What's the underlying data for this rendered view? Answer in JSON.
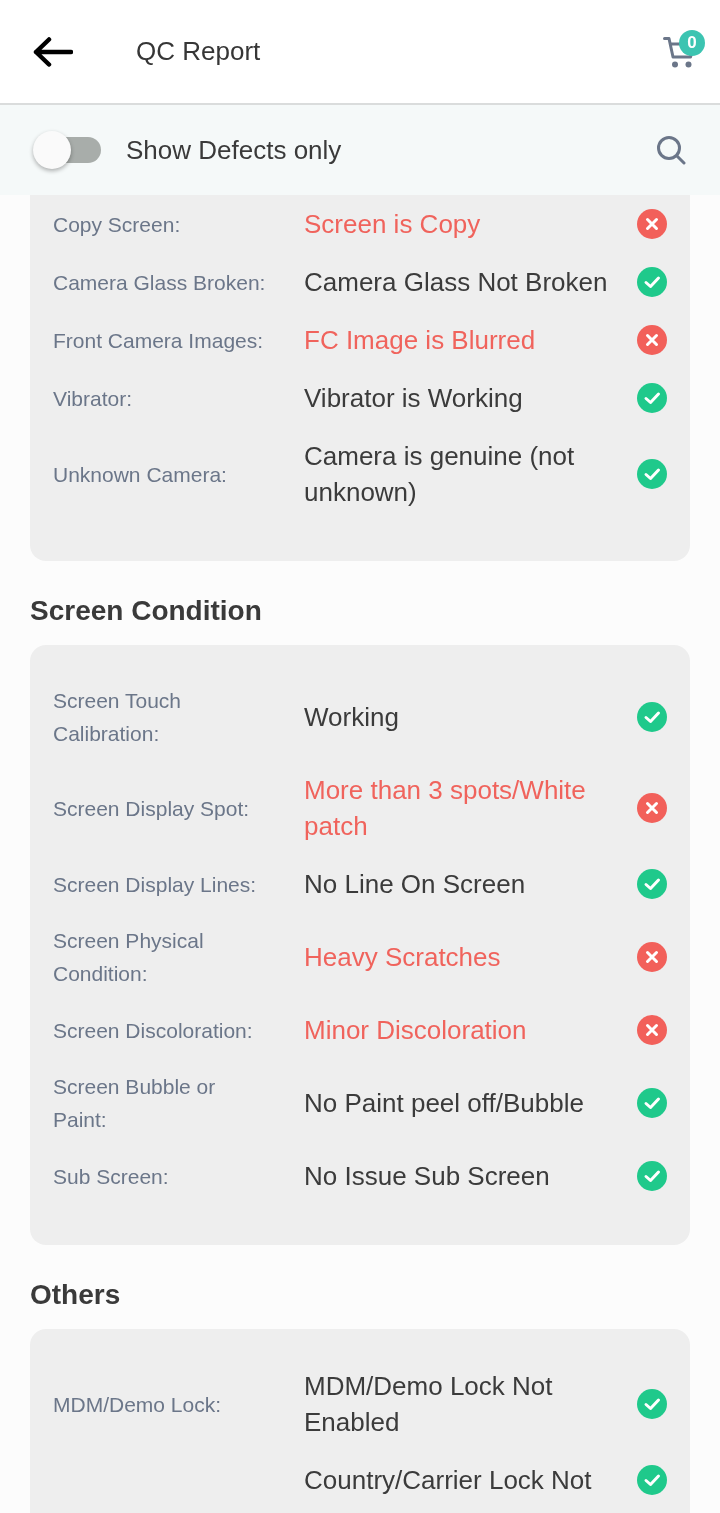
{
  "header": {
    "title": "QC Report",
    "cart_count": "0"
  },
  "filter": {
    "label": "Show Defects only",
    "on": false
  },
  "sections": [
    {
      "rows": [
        {
          "label": "Copy Screen:",
          "value": "Screen is Copy",
          "defect": true
        },
        {
          "label": "Camera Glass Broken:",
          "value": "Camera Glass Not Broken",
          "defect": false
        },
        {
          "label": "Front Camera Images:",
          "value": "FC Image is Blurred",
          "defect": true
        },
        {
          "label": "Vibrator:",
          "value": "Vibrator is Working",
          "defect": false
        },
        {
          "label": "Unknown Camera:",
          "value": "Camera is genuine (not unknown)",
          "defect": false
        }
      ]
    },
    {
      "title": "Screen Condition",
      "rows": [
        {
          "label": "Screen Touch Calibration:",
          "value": "Working",
          "defect": false
        },
        {
          "label": "Screen Display Spot:",
          "value": "More than 3 spots/White patch",
          "defect": true
        },
        {
          "label": "Screen Display Lines:",
          "value": "No Line On Screen",
          "defect": false
        },
        {
          "label": "Screen Physical Condition:",
          "value": "Heavy Scratches",
          "defect": true
        },
        {
          "label": "Screen Discoloration:",
          "value": "Minor Discoloration",
          "defect": true
        },
        {
          "label": "Screen Bubble or Paint:",
          "value": "No Paint peel off/Bubble",
          "defect": false
        },
        {
          "label": "Sub Screen:",
          "value": "No Issue Sub Screen",
          "defect": false
        }
      ]
    },
    {
      "title": "Others",
      "rows": [
        {
          "label": "MDM/Demo Lock:",
          "value": "MDM/Demo Lock Not Enabled",
          "defect": false
        },
        {
          "value": "Country/Carrier Lock Not",
          "defect": false
        }
      ]
    }
  ]
}
